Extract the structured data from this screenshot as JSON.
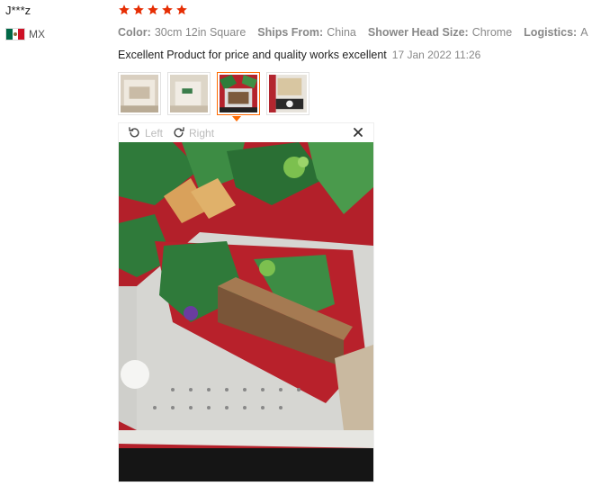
{
  "review": {
    "username": "J***z",
    "country_code": "MX",
    "rating": 5,
    "star_color": "#e62e04",
    "attributes": [
      {
        "key": "Color:",
        "value": "30cm 12in Square"
      },
      {
        "key": "Ships From:",
        "value": "China"
      },
      {
        "key": "Shower Head Size:",
        "value": "Chrome"
      },
      {
        "key": "Logistics:",
        "value": "A"
      }
    ],
    "text": "Excellent Product for price and quality works excellent",
    "date": "17 Jan 2022 11:26",
    "thumbnails": [
      "photo-1",
      "photo-2",
      "photo-3",
      "photo-4"
    ],
    "active_thumbnail": 3
  },
  "viewer": {
    "rotate_left_label": "Left",
    "rotate_right_label": "Right",
    "close_icon": "close-icon",
    "rotate_left_icon": "rotate-left-icon",
    "rotate_right_icon": "rotate-right-icon"
  },
  "colors": {
    "accent": "#ff6a00",
    "muted_text": "#888888"
  }
}
